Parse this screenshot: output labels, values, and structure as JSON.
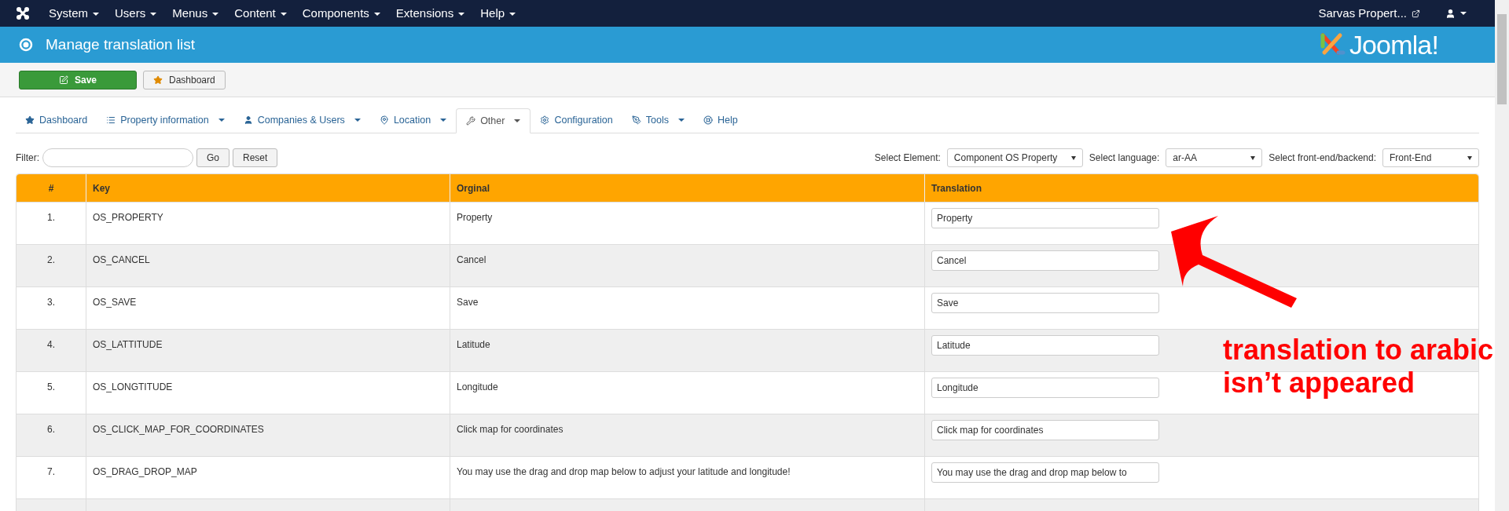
{
  "top_menu": [
    {
      "label": "System"
    },
    {
      "label": "Users"
    },
    {
      "label": "Menus"
    },
    {
      "label": "Content"
    },
    {
      "label": "Components"
    },
    {
      "label": "Extensions"
    },
    {
      "label": "Help"
    }
  ],
  "site_link": "Sarvas Propert...",
  "header": {
    "title": "Manage translation list",
    "logo": "Joomla!"
  },
  "toolbar": [
    {
      "label": "Save",
      "kind": "primary"
    },
    {
      "label": "Dashboard",
      "kind": "default"
    }
  ],
  "tabs": [
    {
      "label": "Dashboard",
      "dropdown": false,
      "selected": false
    },
    {
      "label": "Property information",
      "dropdown": true,
      "selected": false
    },
    {
      "label": "Companies & Users",
      "dropdown": true,
      "selected": false
    },
    {
      "label": "Location",
      "dropdown": true,
      "selected": false
    },
    {
      "label": "Other",
      "dropdown": true,
      "selected": true
    },
    {
      "label": "Configuration",
      "dropdown": false,
      "selected": false
    },
    {
      "label": "Tools",
      "dropdown": true,
      "selected": false
    },
    {
      "label": "Help",
      "dropdown": false,
      "selected": false
    }
  ],
  "filter": {
    "label": "Filter:",
    "buttons": [
      "Go",
      "Reset"
    ]
  },
  "selects": [
    {
      "label": "Select Element:",
      "value": "Component OS Property"
    },
    {
      "label": "Select language:",
      "value": "ar-AA"
    },
    {
      "label": "Select front-end/backend:",
      "value": "Front-End"
    }
  ],
  "table": {
    "columns": [
      "#",
      "Key",
      "Orginal",
      "Translation"
    ],
    "rows": [
      {
        "number": "1.",
        "key": "OS_PROPERTY",
        "original": "Property",
        "translation": "Property"
      },
      {
        "number": "2.",
        "key": "OS_CANCEL",
        "original": "Cancel",
        "translation": "Cancel"
      },
      {
        "number": "3.",
        "key": "OS_SAVE",
        "original": "Save",
        "translation": "Save"
      },
      {
        "number": "4.",
        "key": "OS_LATTITUDE",
        "original": "Latitude",
        "translation": "Latitude"
      },
      {
        "number": "5.",
        "key": "OS_LONGTITUDE",
        "original": "Longitude",
        "translation": "Longitude"
      },
      {
        "number": "6.",
        "key": "OS_CLICK_MAP_FOR_COORDINATES",
        "original": "Click map for coordinates",
        "translation": "Click map for coordinates"
      },
      {
        "number": "7.",
        "key": "OS_DRAG_DROP_MAP",
        "original": "You may use the drag and drop map below to adjust your latitude and longitude!",
        "translation": "You may use the drag and drop map below to"
      }
    ]
  },
  "annotation": {
    "text": "translation to arabic isn’t appeared"
  }
}
